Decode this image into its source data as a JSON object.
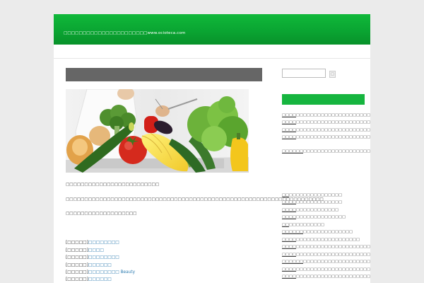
{
  "header": {
    "title": "□□□□□□□□□□□□□□□□□□□□□□www.ocioteca.com"
  },
  "post": {
    "title": "",
    "image_alt": "vegetables",
    "paragraphs": [
      "□□□□□□□□□□□□□□□□□□□□□□□□□",
      "□□□□□□□□□□□□□□□□□□□□□□□□□□□□□□□□□□□□□□□□□□□□□□□□□□□□□□□□□□□□□□□□□□□□□",
      "□□□□□□□□□□□□□□□□□□□"
    ],
    "meta": [
      {
        "label": "[□□□□□]",
        "link": "□□□□□□□□"
      },
      {
        "label": "[□□□□□]",
        "link": "□□□□"
      },
      {
        "label": "[□□□□□]",
        "link": "□□□□□□□□"
      },
      {
        "label": "[□□□□□]",
        "link": "□□□□□□"
      },
      {
        "label": "[□□□□□]",
        "link": "□□□□□□□□ Beauty"
      },
      {
        "label": "[□□□□□]",
        "link": "□□□□□□"
      }
    ]
  },
  "sidebar": {
    "search_placeholder": "",
    "search_button": "□",
    "widget_title": "",
    "recent_links": [
      {
        "link": "□□□□",
        "text": "□□□□□□□□□□□□□□□□□□□□□□□□□□□□□□□□"
      },
      {
        "link": "□□□□",
        "text": "□□□□□□□□□□□□□□□□□□□□□□□□□□□□□□□□□□□"
      },
      {
        "link": "□□□□",
        "text": "□□□□□□□□□□□□□□□□□□□□□□□□□□□□□□□□□□□□□□□"
      },
      {
        "link": "□□□□",
        "text": "□□□□□□□□□□□□□□□□□□□□□□□□□□□"
      },
      {
        "link": "□□□□□□",
        "text": "□□□□□□□□□□□□□□□□□□□□□□□□□□□□□□□□□□□□□□□□□□□□□□□□□"
      }
    ],
    "category_links": [
      {
        "link": "□□",
        "text": "□□□□□□□□□□□□□□□"
      },
      {
        "link": "□□□□",
        "text": "□□□□□□□□□□□□□"
      },
      {
        "link": "□□□□",
        "text": "□□□□□□□□□□□□"
      },
      {
        "link": "□□□□",
        "text": "□□□□□□□□□□□□□□"
      },
      {
        "link": "□□",
        "text": "□□□□□□□□□□"
      },
      {
        "link": "□□□□□□",
        "text": "□□□□□□□□□□□□□□"
      },
      {
        "link": "□□□□",
        "text": "□□□□□□□□□□□□□□□□□□"
      },
      {
        "link": "□□□□",
        "text": "□□□□□□□□□□□□□□□□□□□□□□□□□□□□□□"
      },
      {
        "link": "□□□□",
        "text": "□□□□□□□□□□□□□□□□□□□□□□□□□"
      },
      {
        "link": "□□□□□□",
        "text": "□□□□□□□□□□□□□□□□□□□□□□□□□□□□□□□□"
      },
      {
        "link": "□□□□",
        "text": "□□□□□□□□□□□□□□□□□□□□□□□□□□□□□□"
      },
      {
        "link": "□□□□",
        "text": "□□□□□□□□□□□□□□□□□□□□□□□□"
      }
    ]
  }
}
